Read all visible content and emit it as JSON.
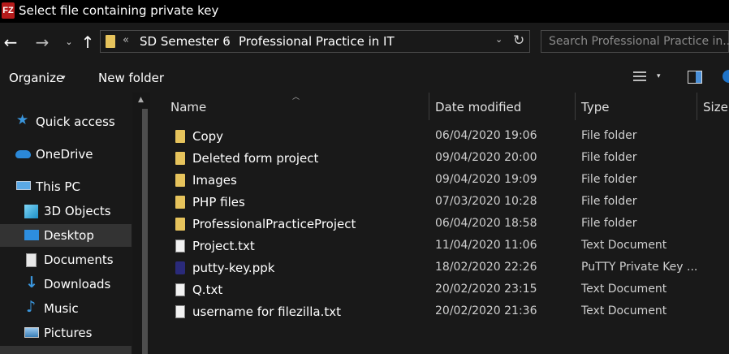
{
  "window": {
    "title": "Select file containing private key",
    "app_icon": "FZ"
  },
  "nav": {
    "back": "←",
    "forward": "→",
    "recent": "⌄",
    "up": "↑"
  },
  "address": {
    "chevron": "«",
    "segments": [
      "SD Semester 6",
      "Professional Practice in IT"
    ],
    "separator": "›",
    "dropdown": "⌄",
    "refresh": "↻"
  },
  "search": {
    "placeholder": "Search Professional Practice in..."
  },
  "toolbar": {
    "organize_label": "Organize",
    "organize_dd": "▾",
    "new_folder_label": "New folder",
    "view_dd": "▾"
  },
  "sidebar": {
    "items": [
      {
        "label": "Quick access",
        "icon": "star-icon"
      },
      {
        "label": "OneDrive",
        "icon": "cloud-icon"
      },
      {
        "label": "This PC",
        "icon": "computer-icon"
      },
      {
        "label": "3D Objects",
        "icon": "cube-icon"
      },
      {
        "label": "Desktop",
        "icon": "desktop-icon",
        "selected": true
      },
      {
        "label": "Documents",
        "icon": "documents-icon"
      },
      {
        "label": "Downloads",
        "icon": "download-icon"
      },
      {
        "label": "Music",
        "icon": "music-icon"
      },
      {
        "label": "Pictures",
        "icon": "pictures-icon"
      }
    ]
  },
  "columns": {
    "name": "Name",
    "date": "Date modified",
    "type": "Type",
    "size": "Size"
  },
  "files": [
    {
      "name": "Copy",
      "date": "06/04/2020 19:06",
      "type": "File folder",
      "kind": "folder"
    },
    {
      "name": "Deleted form project",
      "date": "09/04/2020 20:00",
      "type": "File folder",
      "kind": "folder"
    },
    {
      "name": "Images",
      "date": "09/04/2020 19:09",
      "type": "File folder",
      "kind": "folder"
    },
    {
      "name": "PHP files",
      "date": "07/03/2020 10:28",
      "type": "File folder",
      "kind": "folder"
    },
    {
      "name": "ProfessionalPracticeProject",
      "date": "06/04/2020 18:58",
      "type": "File folder",
      "kind": "folder"
    },
    {
      "name": "Project.txt",
      "date": "11/04/2020 11:06",
      "type": "Text Document",
      "kind": "txt"
    },
    {
      "name": "putty-key.ppk",
      "date": "18/02/2020 22:26",
      "type": "PuTTY Private Key ...",
      "kind": "ppk"
    },
    {
      "name": "Q.txt",
      "date": "20/02/2020 23:15",
      "type": "Text Document",
      "kind": "txt"
    },
    {
      "name": "username for filezilla.txt",
      "date": "20/02/2020 21:36",
      "type": "Text Document",
      "kind": "txt"
    }
  ],
  "colors": {
    "background": "#191919",
    "selected": "#333333",
    "folder": "#e6c35c",
    "accent": "#1e73c8"
  }
}
